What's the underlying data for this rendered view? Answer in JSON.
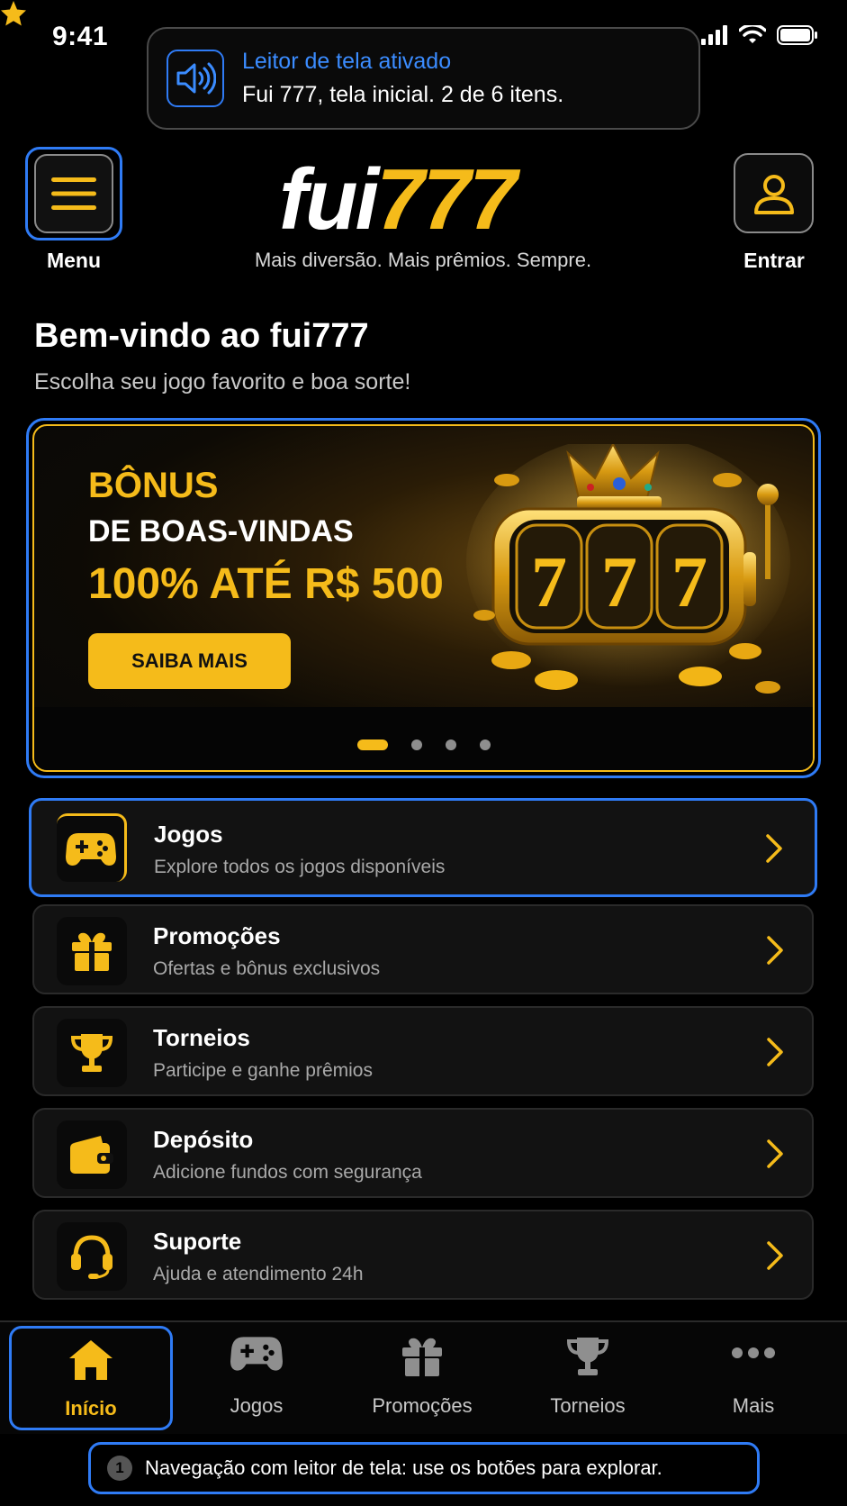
{
  "status_bar": {
    "time": "9:41"
  },
  "screen_reader_toast": {
    "title": "Leitor de tela ativado",
    "description": "Fui 777, tela inicial. 2 de 6 itens."
  },
  "header": {
    "menu_label": "Menu",
    "login_label": "Entrar",
    "logo_text_white": "fui",
    "logo_text_gold": "777",
    "tagline": "Mais diversão. Mais prêmios. Sempre."
  },
  "welcome": {
    "title": "Bem-vindo ao fui777",
    "subtitle": "Escolha seu jogo favorito e boa sorte!"
  },
  "banner": {
    "line1": "BÔNUS",
    "line2": "DE BOAS-VINDAS",
    "line3": "100% ATÉ R$ 500",
    "cta": "SAIBA MAIS",
    "slides_total": 4,
    "active_slide": 1
  },
  "menu_list": [
    {
      "title": "Jogos",
      "description": "Explore todos os jogos disponíveis",
      "icon": "gamepad-icon"
    },
    {
      "title": "Promoções",
      "description": "Ofertas e bônus exclusivos",
      "icon": "gift-icon"
    },
    {
      "title": "Torneios",
      "description": "Participe e ganhe prêmios",
      "icon": "trophy-icon"
    },
    {
      "title": "Depósito",
      "description": "Adicione fundos com segurança",
      "icon": "wallet-icon"
    },
    {
      "title": "Suporte",
      "description": "Ajuda e atendimento 24h",
      "icon": "headset-icon"
    }
  ],
  "bottom_nav": [
    {
      "label": "Início",
      "icon": "home-icon",
      "active": true
    },
    {
      "label": "Jogos",
      "icon": "gamepad-icon",
      "active": false
    },
    {
      "label": "Promoções",
      "icon": "gift-icon",
      "active": false
    },
    {
      "label": "Torneios",
      "icon": "trophy-icon",
      "active": false
    },
    {
      "label": "Mais",
      "icon": "more-icon",
      "active": false
    }
  ],
  "hint": {
    "number": "1",
    "text": "Navegação com leitor de tela: use os botões para explorar."
  },
  "colors": {
    "accent_gold": "#f5bb1a",
    "focus_blue": "#2f7bf5",
    "background": "#000000"
  }
}
